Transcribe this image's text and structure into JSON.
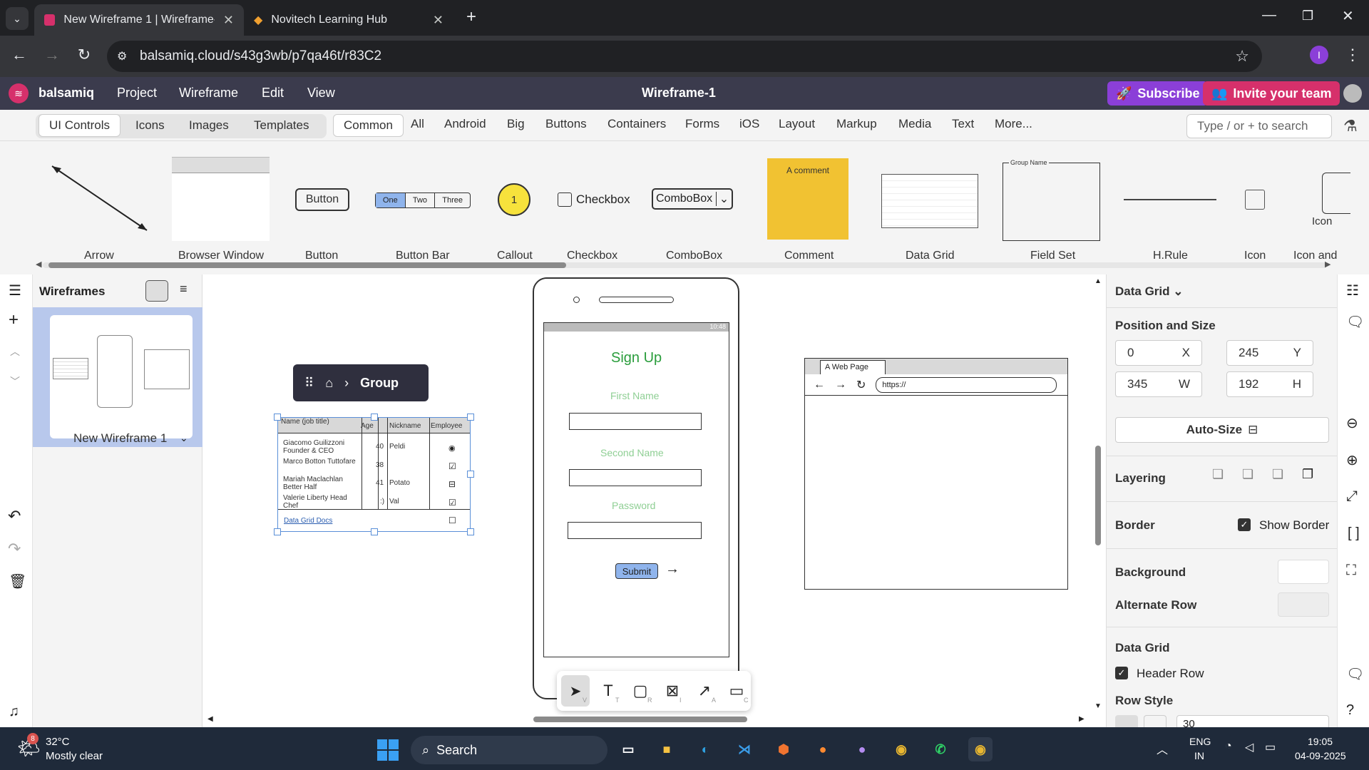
{
  "browser": {
    "tabs": [
      {
        "title": "New Wireframe 1 | Wireframe-1"
      },
      {
        "title": "Novitech Learning Hub"
      }
    ],
    "url": "balsamiq.cloud/s43g3wb/p7qa46t/r83C2",
    "profile_initial": "I"
  },
  "app": {
    "brand": "balsamiq",
    "menus": [
      "Project",
      "Wireframe",
      "Edit",
      "View"
    ],
    "doc_title": "Wireframe-1",
    "subscribe": "Subscribe",
    "invite": "Invite your team"
  },
  "library": {
    "segments": [
      "UI Controls",
      "Icons",
      "Images",
      "Templates"
    ],
    "categories": [
      "Common",
      "All",
      "Android",
      "Big",
      "Buttons",
      "Containers",
      "Forms",
      "iOS",
      "Layout",
      "Markup",
      "Media",
      "Text",
      "More..."
    ],
    "search_placeholder": "Type / or + to search",
    "items": [
      "Arrow",
      "Browser Window",
      "Button",
      "Button Bar",
      "Callout",
      "Checkbox",
      "ComboBox",
      "Comment",
      "Data Grid",
      "Field Set",
      "H.Rule",
      "Icon",
      "Icon and"
    ],
    "previews": {
      "button": "Button",
      "bar": [
        "One",
        "Two",
        "Three"
      ],
      "callout": "1",
      "checkbox": "Checkbox",
      "combo": "ComboBox",
      "comment": "A comment",
      "fieldset": "Group Name",
      "icon": "Icon"
    }
  },
  "wireframes": {
    "title": "Wireframes",
    "item": "New Wireframe 1"
  },
  "canvas": {
    "breadcrumb": "Group",
    "grid": {
      "headers": [
        "Name (job title)",
        "Age",
        "Nickname",
        "Employee"
      ],
      "rows": [
        [
          "Giacomo Guilizzoni Founder & CEO",
          "40",
          "Peldi"
        ],
        [
          "Marco Botton Tuttofare",
          "38",
          ""
        ],
        [
          "Mariah Maclachlan Better Half",
          "41",
          "Potato"
        ],
        [
          "Valerie Liberty Head Chef",
          ":)",
          "Val"
        ]
      ],
      "link": "Data Grid Docs"
    },
    "phone": {
      "status": "10:48",
      "title": "Sign Up",
      "first": "First Name",
      "second": "Second Name",
      "password": "Password",
      "submit": "Submit"
    },
    "web": {
      "title": "A Web Page",
      "url": "https://"
    },
    "tools": [
      "V",
      "T",
      "R",
      "I",
      "A",
      "C"
    ]
  },
  "props": {
    "title": "Data Grid",
    "pos_label": "Position and Size",
    "x": "0",
    "x_label": "X",
    "y": "245",
    "y_label": "Y",
    "w": "345",
    "w_label": "W",
    "h": "192",
    "h_label": "H",
    "autosize": "Auto-Size",
    "layering": "Layering",
    "border": "Border",
    "show_border": "Show Border",
    "background": "Background",
    "alt_row": "Alternate Row",
    "datagrid": "Data Grid",
    "header_row": "Header Row",
    "row_style": "Row Style",
    "row_value": "30",
    "colors": {
      "accent": "#8b3fd8",
      "invite": "#d6306b",
      "grid_select": "#5a8fd8"
    }
  },
  "taskbar": {
    "temp": "32°C",
    "weather": "Mostly clear",
    "badge": "8",
    "search": "Search",
    "lang1": "ENG",
    "lang2": "IN",
    "time": "19:05",
    "date": "04-09-2025"
  }
}
